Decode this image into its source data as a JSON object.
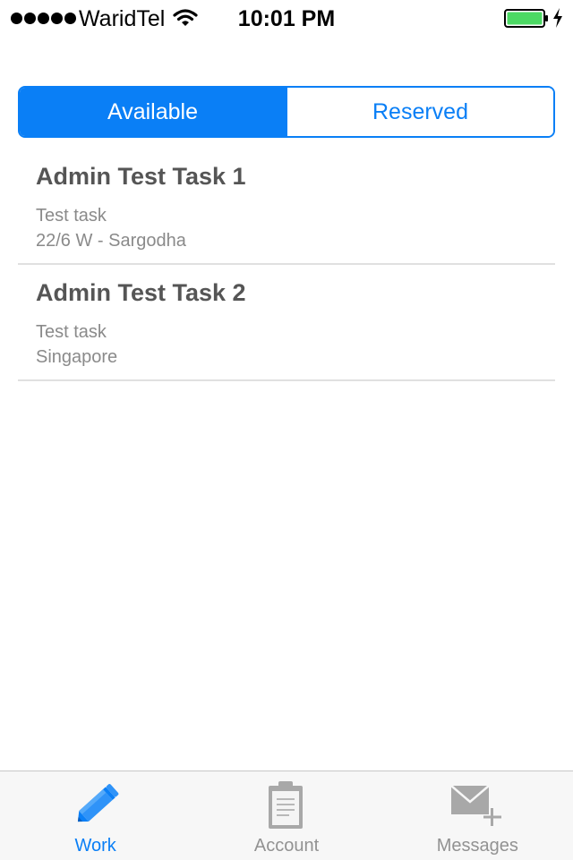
{
  "status_bar": {
    "carrier": "WaridTel",
    "time": "10:01 PM",
    "signal_bars": 5,
    "battery_level": 1.0,
    "battery_color": "#4cd964",
    "wifi": "wifi-icon",
    "charging": "charging-bolt-icon"
  },
  "segmented_control": {
    "selected": "Available",
    "segments": [
      "Available",
      "Reserved"
    ],
    "accent_color": "#0a7ff6"
  },
  "tasks": [
    {
      "title": "Admin Test Task 1",
      "description": "Test task",
      "location": "22/6 W - Sargodha"
    },
    {
      "title": "Admin Test Task 2",
      "description": "Test task",
      "location": "Singapore"
    }
  ],
  "tab_bar": {
    "selected": "Work",
    "tabs": [
      {
        "label": "Work",
        "icon": "pencil-icon"
      },
      {
        "label": "Account",
        "icon": "clipboard-icon"
      },
      {
        "label": "Messages",
        "icon": "mail-add-icon"
      }
    ]
  }
}
